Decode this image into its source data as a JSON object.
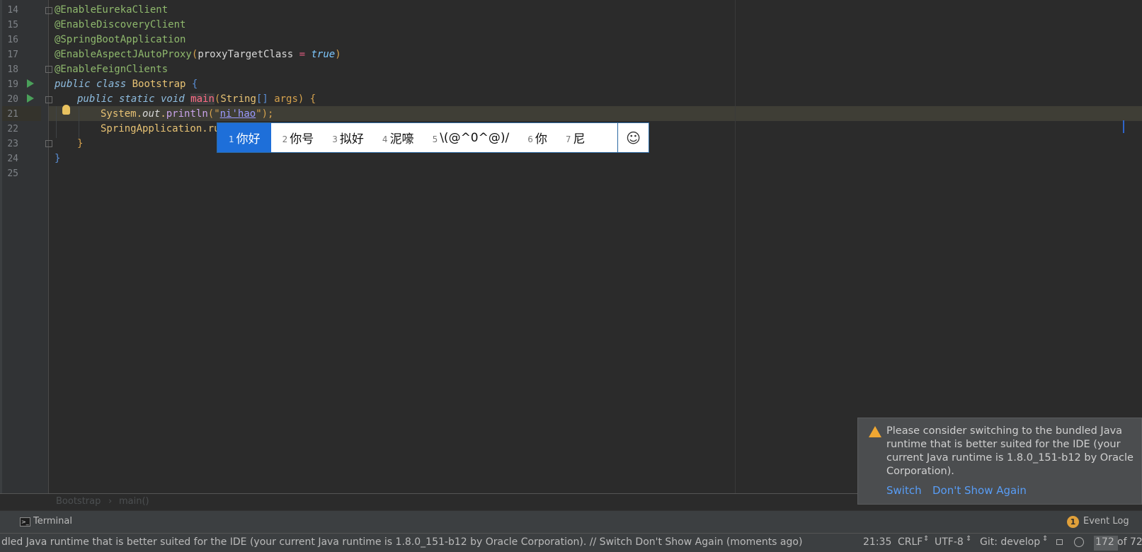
{
  "editor": {
    "line_numbers": [
      "14",
      "15",
      "16",
      "17",
      "18",
      "19",
      "20",
      "21",
      "22",
      "23",
      "24",
      "25"
    ],
    "lines": {
      "l14": "@EnableEurekaClient",
      "l15": "@EnableDiscoveryClient",
      "l16": "@SpringBootApplication",
      "l17_ann": "@EnableAspectJAutoProxy",
      "l17_open": "(",
      "l17_arg": "proxyTargetClass",
      "l17_eq": " = ",
      "l17_val": "true",
      "l17_close": ")",
      "l18": "@EnableFeignClients",
      "l19_kw": "public class",
      "l19_name": "Bootstrap",
      "l19_brace": "{",
      "l20_kw": "public static void",
      "l20_meth": "main",
      "l20_open": "(",
      "l20_type": "String",
      "l20_arr": "[]",
      "l20_arg": "args",
      "l20_close": ")",
      "l20_brace": "{",
      "l21_obj": "System.",
      "l21_field": "out",
      "l21_dot": ".",
      "l21_call": "println",
      "l21_open": "(\"",
      "l21_ime": "ni'hao",
      "l21_close": "\");",
      "l22": "SpringApplication.run",
      "l23": "}",
      "l24": "}"
    }
  },
  "ime": {
    "candidates": [
      {
        "num": "1",
        "text": "你好"
      },
      {
        "num": "2",
        "text": "你号"
      },
      {
        "num": "3",
        "text": "拟好"
      },
      {
        "num": "4",
        "text": "泥嚎"
      },
      {
        "num": "5",
        "text": "\\(@^0^@)/"
      },
      {
        "num": "6",
        "text": "你"
      },
      {
        "num": "7",
        "text": "尼"
      }
    ],
    "emoji_button": "☺",
    "selected_index": 0
  },
  "breadcrumb": {
    "class": "Bootstrap",
    "separator": "›",
    "method": "main()"
  },
  "toolwindow": {
    "terminal": "Terminal",
    "event_log": "Event Log",
    "event_count": "1"
  },
  "notification": {
    "message": "Please consider switching to the bundled Java runtime that is better suited for the IDE (your current Java runtime is 1.8.0_151-b12 by Oracle Corporation).",
    "switch": "Switch",
    "dont_show": "Don't Show Again"
  },
  "statusbar": {
    "message": "dled Java runtime that is better suited for the IDE (your current Java runtime is 1.8.0_151-b12 by Oracle Corporation). // Switch Don't Show Again (moments ago)",
    "position": "21:35",
    "line_sep": "CRLF",
    "encoding": "UTF-8",
    "git": "Git: develop",
    "memory_used": "172",
    "memory_total": "of 72"
  },
  "colors": {
    "background": "#2b2b2b",
    "annotation": "#8fb96d",
    "keyword": "#8fbde0",
    "selected_candidate": "#1e6fd9",
    "link": "#589df6",
    "warning": "#f0a732"
  }
}
